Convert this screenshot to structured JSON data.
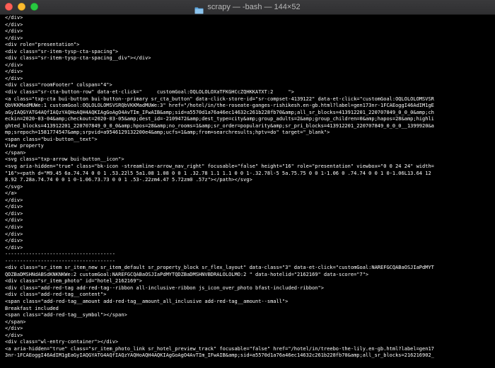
{
  "window": {
    "title": "scrapy — -bash — 144×52",
    "folder_icon": "folder-icon",
    "colors": {
      "background": "#000000",
      "text": "#ffffff",
      "titlebar": "#343436",
      "folder": "#5fa8e0"
    }
  },
  "terminal": {
    "lines": [
      "</div>",
      "</div>",
      "</div>",
      "</div>",
      "<div role=\"presentation\">",
      "<div class=\"sr-item-tysp-cta-spacing\">",
      "<div class=\"sr-item-tysp-cta-spacing__div\"></div>",
      "</div>",
      "</div>",
      "</div>",
      "<div class=\"roomFooter\" colspan=\"4\">",
      "<div class=\"sr-cta-button-row\" data-et-click=\"     customGoal:OQLOLOLOXaTFKGHCcZQHKKATXT:2     \">",
      "<a class=\"txp-cta bui-button bui-button--primary sr_cta_button\" data-click-store-id=\"sr-compset-4139122\" data-et-click=\"customGoal:OQLOLOLOMSVSR",
      "QbVKKMadMUWe:1 customGoal:OQLOLOLOMSVSRQbVKKMadMUWe:3\" href=\"/hotel/in/the-roseate-ganges-rishikesh.en-gb.html?label=gen173nr-1FCAEoggI46AdIM1gE",
      "aGyIAQGYATG4AQfIAQzYAQHoAQH4AQKIAgGoAgO4AvTIm_IFwAIB&amp;sid=a5570d1a76a46ec14632c261b228fb70&amp;all_sr_blocks=413912201_220707849_0_0_0&amp;ch",
      "eckin=2020-03-04&amp;checkout=2020-03-05&amp;dest_id=-2109472&amp;dest_type=city&amp;group_adults=2&amp;group_children=0&amp;hapos=28&amp;highli",
      "ghted_blocks=413912201_220707849_0_0_0&amp;hpos=28&amp;no_rooms=1&amp;sr_order=popularity&amp;sr_pri_blocks=413912201_220707849_0_0_0__1399920&a",
      "mp;srepoch=1581774547&amp;srpvid=a9546129132200e4&amp;ucfs=1&amp;from=searchresults;hptv=do\" target=\"_blank\">",
      "<span class=\"bui-button__text\">",
      "View property",
      "</span>",
      "<svg class=\"txp-arrow bui-button__icon\">",
      "<svg aria-hidden=\"true\" class=\"bk-icon -streamline-arrow_nav_right\" focusable=\"false\" height=\"16\" role=\"presentation\" viewbox=\"0 0 24 24\" width=",
      "\"16\"><path d=\"M9.45 6a.74.74 0 0 1 .53.22l5 5a1.08 1.08 0 0 1 .32.78 1.1 1.1 0 0 1-.32.78l-5 5a.75.75 0 0 1-1.06 0 .74.74 0 0 1 0-1.06L13.64 12",
      "8.92 7.28a.74.74 0 0 1 0-1.06.73.73 0 0 1 .53-.22zm4.47 5.72zm0 .57z\"></path></svg>",
      "</svg>",
      "</a>",
      "</div>",
      "</div>",
      "</div>",
      "</div>",
      "</div>",
      "</div>",
      "</div>",
      "</div>",
      "-------------------------------------",
      "-------------------------------------",
      "<div class=\"sr_item sr_item_new sr_item_default sr_property_block sr_flex_layout\" data-class=\"3\" data-et-click=\"customGoal:NAREFGCQABaOSJIaPdMYT",
      "QDZBaDMSHNdABSdKNKNKWe:2 customGoal:NAREFGCQABaOSJIaPdMYTQDZBaDMSHNVBDRALOLOLMO:2 \" data-hotelid=\"2162169\" data-score=\"7\">",
      "<div class=\"sr_item_photo\" id=\"hotel_2162169\">",
      "<div class=\"add-red-tag add-red-tag--ribbon all-inclusive-ribbon js_icon_over_photo bfast-included-ribbon\">",
      "<div class=\"add-red-tag__content\">",
      "<span class=\"add-red-tag__amount add-red-tag__amount_all_inclusive add-red-tag__amount--small\">",
      "Breakfast included",
      "<span class=\"add-red-tag__symbol\"></span>",
      "</span>",
      "</div>",
      "</div>",
      "<div class=\"wl-entry-container\"></div>",
      "<a aria-hidden=\"true\" class=\"sr_item_photo_link sr_hotel_preview_track\" focusable=\"false\" href=\"/hotel/in/treebo-the-lily.en-gb.html?label=gen17",
      "3nr-1FCAEoggI46AdIM1gEaGyIAQGYATG4AQfIAQzYAQHoAQH4AQKIAgGoAgO4AvTIm_IFwAIB&amp;sid=a5570d1a76a46ec14632c261b228fb70&amp;all_sr_blocks=216216902_"
    ]
  }
}
